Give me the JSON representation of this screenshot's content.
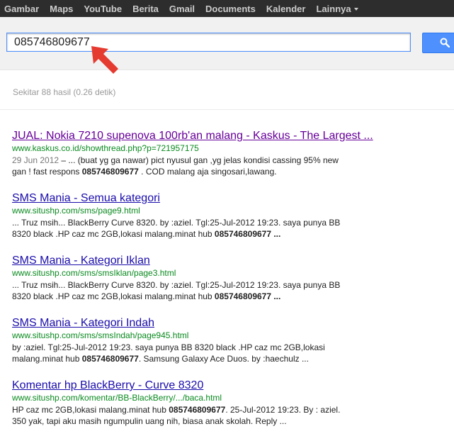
{
  "topnav": {
    "items": [
      "Gambar",
      "Maps",
      "YouTube",
      "Berita",
      "Gmail",
      "Documents",
      "Kalender",
      "Lainnya"
    ]
  },
  "search": {
    "query": "085746809677",
    "button_icon": "search-icon"
  },
  "stats": "Sekitar 88 hasil (0.26 detik)",
  "results": [
    {
      "title": "JUAL: Nokia 7210 supenova 100rb'an malang - Kaskus - The Largest ...",
      "url": "www.kaskus.co.id/showthread.php?p=721957175",
      "date": "29 Jun 2012",
      "snippet_line1": "... (buat yg ga nawar) pict nyusul gan ,yg jelas kondisi cassing 95% new",
      "snippet_line2_pre": "gan ! fast respons ",
      "snippet_bold": "085746809677",
      "snippet_line2_post": " . COD malang aja singosari,lawang."
    },
    {
      "title": "SMS Mania - Semua kategori",
      "url": "www.situshp.com/sms/page9.html",
      "snippet_line1": "... Truz msih... BlackBerry Curve 8320. by :aziel. Tgl:25-Jul-2012 19:23. saya punya BB",
      "snippet_line2_pre": "8320 black .HP caz mc 2GB,lokasi malang.minat hub ",
      "snippet_bold": "085746809677",
      "snippet_line2_post": " ..."
    },
    {
      "title": "SMS Mania - Kategori Iklan",
      "url": "www.situshp.com/sms/smsIklan/page3.html",
      "snippet_line1": "... Truz msih... BlackBerry Curve 8320. by :aziel. Tgl:25-Jul-2012 19:23. saya punya BB",
      "snippet_line2_pre": "8320 black .HP caz mc 2GB,lokasi malang.minat hub ",
      "snippet_bold": "085746809677",
      "snippet_line2_post": " ..."
    },
    {
      "title": "SMS Mania - Kategori Indah",
      "url": "www.situshp.com/sms/smsIndah/page945.html",
      "snippet_line1": "by :aziel. Tgl:25-Jul-2012 19:23. saya punya BB 8320 black .HP caz mc 2GB,lokasi",
      "snippet_line2_pre": "malang.minat hub ",
      "snippet_bold": "085746809677",
      "snippet_line2_post": ". Samsung Galaxy Ace Duos. by :haechulz ..."
    },
    {
      "title": "Komentar hp BlackBerry - Curve 8320",
      "url": "www.situshp.com/komentar/BB-BlackBerry/.../baca.html",
      "snippet_line1_pre": "HP caz mc 2GB,lokasi malang.minat hub ",
      "snippet_line1_bold": "085746809677",
      "snippet_line1_post": ". 25-Jul-2012 19:23. By : aziel.",
      "snippet_line2": "350 yak, tapi aku masih ngumpulin uang nih, biasa anak skolah. Reply ..."
    }
  ]
}
